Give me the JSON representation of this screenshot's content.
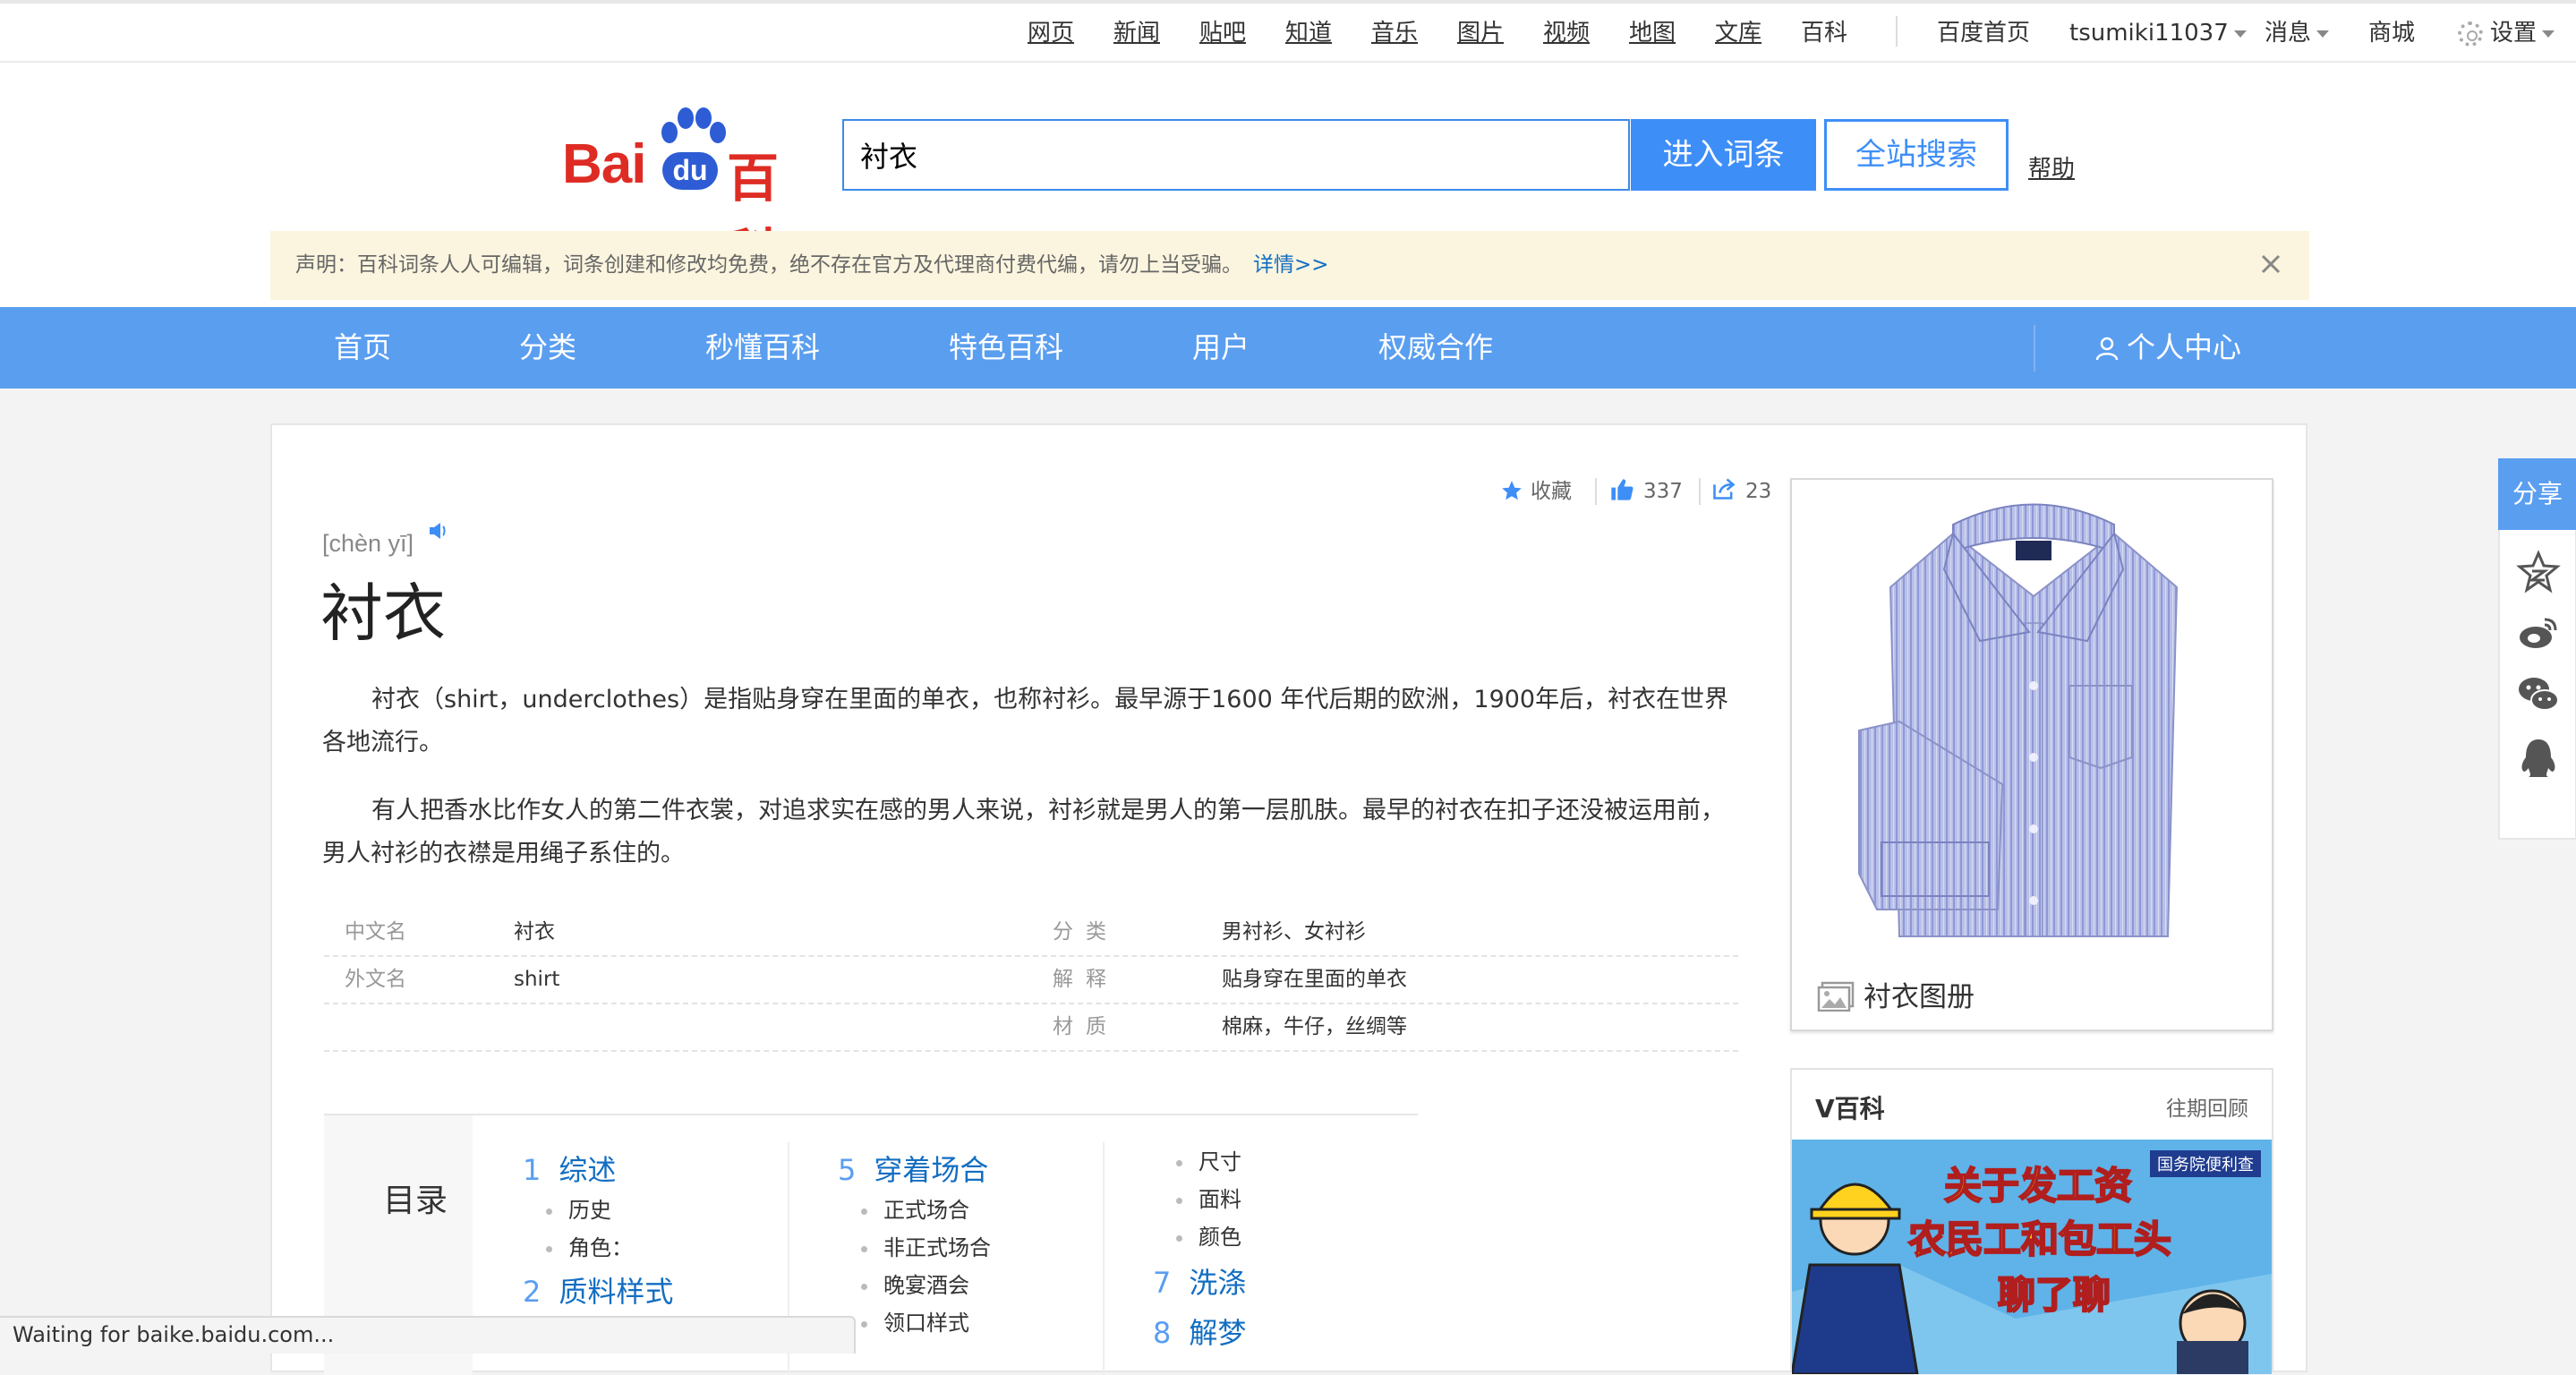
{
  "topbar": {
    "links": [
      "网页",
      "新闻",
      "贴吧",
      "知道",
      "音乐",
      "图片",
      "视频",
      "地图",
      "文库"
    ],
    "current": "百科",
    "home": "百度首页",
    "user": "tsumiki11037",
    "messages": "消息",
    "mall": "商城",
    "settings": "设置"
  },
  "logo": {
    "bai": "Bai",
    "du": "du",
    "baike": "百科"
  },
  "search": {
    "value": "衬衣",
    "enter_label": "进入词条",
    "site_label": "全站搜索",
    "help": "帮助"
  },
  "notice": {
    "text": "声明：百科词条人人可编辑，词条创建和修改均免费，绝不存在官方及代理商付费代编，请勿上当受骗。",
    "more": "详情>>"
  },
  "nav": {
    "items": [
      "首页",
      "分类",
      "秒懂百科",
      "特色百科",
      "用户",
      "权威合作"
    ],
    "personal": "个人中心"
  },
  "actions": {
    "collect": "收藏",
    "likes": "337",
    "shares": "23"
  },
  "entry": {
    "pinyin": "[chèn yī]",
    "title": "衬衣",
    "para1": "衬衣（shirt，underclothes）是指贴身穿在里面的单衣，也称衬衫。最早源于1600 年代后期的欧洲，1900年后，衬衣在世界各地流行。",
    "para2": "有人把香水比作女人的第二件衣裳，对追求实在感的男人来说，衬衫就是男人的第一层肌肤。最早的衬衣在扣子还没被运用前，男人衬衫的衣襟是用绳子系住的。"
  },
  "basic_info": [
    {
      "l1": "中文名",
      "v1": "衬衣",
      "l2": "分类",
      "v2": "男衬衫、女衬衫"
    },
    {
      "l1": "外文名",
      "v1": "shirt",
      "l2": "解释",
      "v2": "贴身穿在里面的单衣"
    },
    {
      "l1": "",
      "v1": "",
      "l2": "材质",
      "v2": "棉麻，牛仔，丝绸等"
    }
  ],
  "catalog": {
    "title": "目录",
    "h1": {
      "n": "1",
      "t": "综述"
    },
    "h1_subs": [
      "历史",
      "角色："
    ],
    "h2": {
      "n": "2",
      "t": "质料样式"
    },
    "h5": {
      "n": "5",
      "t": "穿着场合"
    },
    "h5_subs": [
      "正式场合",
      "非正式场合",
      "晚宴酒会",
      "领口样式"
    ],
    "col3_subs": [
      "尺寸",
      "面料",
      "颜色"
    ],
    "h7": {
      "n": "7",
      "t": "洗涤"
    },
    "h8": {
      "n": "8",
      "t": "解梦"
    }
  },
  "album": {
    "caption": "衬衣图册"
  },
  "vbaike": {
    "title": "V百科",
    "more": "往期回顾",
    "banner_lines": [
      "关于发工资",
      "农民工和包工头",
      "聊了聊"
    ],
    "badge": "国务院便利查"
  },
  "share": {
    "title": "分享",
    "icons": [
      "qzone-icon",
      "weibo-icon",
      "wechat-icon",
      "qq-icon"
    ]
  },
  "status": {
    "text": "Waiting for baike.baidu.com..."
  }
}
